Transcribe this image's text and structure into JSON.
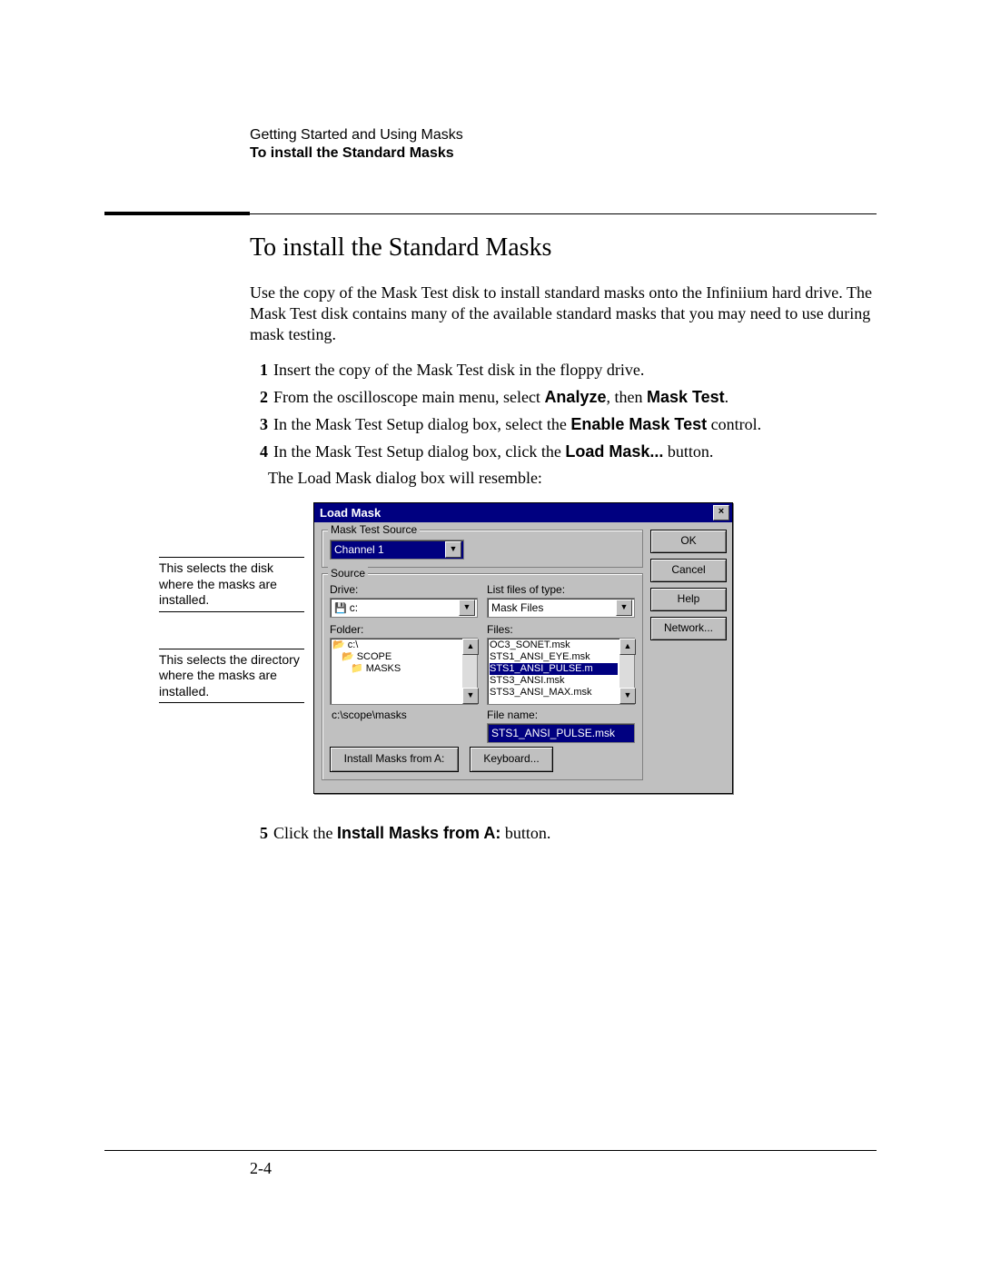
{
  "header": {
    "breadcrumb": "Getting Started and Using Masks",
    "section": "To install the Standard Masks"
  },
  "title": "To install the Standard Masks",
  "intro": "Use the copy of the Mask Test disk to install standard masks onto the Infiniium hard drive.  The Mask Test disk contains many of the available standard masks that you may need to use during mask testing.",
  "steps": {
    "s1": "Insert the copy of the Mask Test disk in the floppy drive.",
    "s2a": "From the oscilloscope main menu, select ",
    "s2b": "Analyze",
    "s2c": ", then ",
    "s2d": "Mask Test",
    "s2e": ".",
    "s3a": "In the Mask Test Setup dialog box, select the ",
    "s3b": "Enable Mask Test",
    "s3c": " control.",
    "s4a": "In the Mask Test Setup dialog box, click the ",
    "s4b": "Load Mask...",
    "s4c": " button.",
    "s4note": "The Load Mask dialog box will resemble:",
    "s5a": "Click the ",
    "s5b": "Install Masks from A:",
    "s5c": " button."
  },
  "callouts": {
    "c1": "This selects the disk where the masks are installed.",
    "c2": "This selects the directory where the masks are installed."
  },
  "dialog": {
    "title": "Load Mask",
    "close": "×",
    "ok": "OK",
    "cancel": "Cancel",
    "help": "Help",
    "network": "Network...",
    "mask_source_label": "Mask Test Source",
    "channel": "Channel 1",
    "source_label": "Source",
    "drive_label": "Drive:",
    "drive_value": "c:",
    "filetype_label": "List files of type:",
    "filetype_value": "Mask Files",
    "folder_label": "Folder:",
    "folders": {
      "f0": "c:\\",
      "f1": "SCOPE",
      "f2": "MASKS"
    },
    "files_label": "Files:",
    "files": {
      "f0": "OC3_SONET.msk",
      "f1": "STS1_ANSI_EYE.msk",
      "f2": "STS1_ANSI_PULSE.m",
      "f3": "STS3_ANSI.msk",
      "f4": "STS3_ANSI_MAX.msk"
    },
    "path": "c:\\scope\\masks",
    "filename_label": "File name:",
    "filename_value": "STS1_ANSI_PULSE.msk",
    "install_btn": "Install Masks from A:",
    "keyboard_btn": "Keyboard..."
  },
  "page_num": "2-4"
}
